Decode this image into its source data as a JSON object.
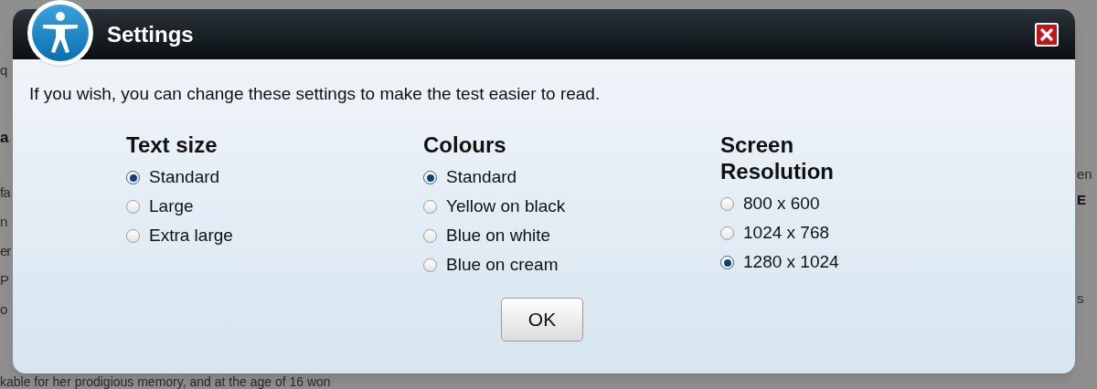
{
  "background": {
    "left_fragments": [
      {
        "text": "q",
        "bold": false
      },
      {
        "text": "a",
        "bold": true
      },
      {
        "text": "fa",
        "bold": false
      },
      {
        "text": "n",
        "bold": false
      },
      {
        "text": "er",
        "bold": false
      },
      {
        "text": "P",
        "bold": false
      },
      {
        "text": "o",
        "bold": false
      }
    ],
    "right_fragments": [
      {
        "text": "en",
        "bold": false
      },
      {
        "text": "E",
        "bold": true
      },
      {
        "text": "s",
        "bold": false
      }
    ],
    "bottom_line": "kable for her prodigious memory, and at the age of 16 won"
  },
  "dialog": {
    "title": "Settings",
    "intro": "If you wish, you can change these settings to make the test easier to read.",
    "groups": [
      {
        "heading": "Text size",
        "options": [
          {
            "label": "Standard",
            "selected": true
          },
          {
            "label": "Large",
            "selected": false
          },
          {
            "label": "Extra large",
            "selected": false
          }
        ]
      },
      {
        "heading": "Colours",
        "options": [
          {
            "label": "Standard",
            "selected": true
          },
          {
            "label": "Yellow on black",
            "selected": false
          },
          {
            "label": "Blue on white",
            "selected": false
          },
          {
            "label": "Blue on cream",
            "selected": false
          }
        ]
      },
      {
        "heading": "Screen Resolution",
        "options": [
          {
            "label": "800 x 600",
            "selected": false
          },
          {
            "label": "1024 x 768",
            "selected": false
          },
          {
            "label": "1280 x 1024",
            "selected": true
          }
        ]
      }
    ],
    "ok_button": "OK"
  }
}
